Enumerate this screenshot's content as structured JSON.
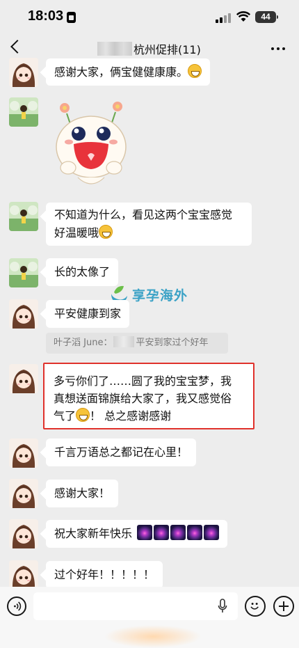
{
  "status_bar": {
    "time": "18:03",
    "battery": "44"
  },
  "header": {
    "title": "杭州促排(11)"
  },
  "messages": [
    {
      "avatar": "girl-avatar",
      "text": "感谢大家，俩宝健健康康。"
    },
    {
      "avatar": "landscape-avatar",
      "sticker": "cartoon-face-sticker"
    },
    {
      "avatar": "landscape-avatar",
      "text_line1": "不知道为什么，看见这两个宝宝感觉",
      "text_line2": "好温暖哦"
    },
    {
      "avatar": "landscape-avatar",
      "text": "长的太像了"
    },
    {
      "avatar": "girl-avatar",
      "text": "平安健康到家"
    },
    {
      "quote_prefix": "叶子滔 June：",
      "quote_suffix": "平安到家过个好年"
    },
    {
      "avatar": "girl-avatar",
      "text_line1": "多亏你们了……圆了我的宝宝梦，我",
      "text_line2": "真想送面锦旗给大家了，我又感觉俗",
      "text_line3_a": "气了",
      "text_line3_b": "！ 总之感谢感谢"
    },
    {
      "avatar": "girl-avatar",
      "text": "千言万语总之都记在心里！"
    },
    {
      "avatar": "girl-avatar",
      "text": "感谢大家！"
    },
    {
      "avatar": "girl-avatar",
      "text": "祝大家新年快乐"
    },
    {
      "avatar": "girl-avatar",
      "text": "过个好年！！！！！"
    }
  ],
  "watermark": {
    "text": "享孕海外"
  },
  "icons": {
    "back": "chevron-left-icon",
    "more": "more-dots-icon",
    "voice": "voice-icon",
    "mic": "microphone-icon",
    "emoji": "emoji-icon",
    "plus": "plus-icon"
  },
  "colors": {
    "highlight_border": "#e0312b",
    "background": "#ededed",
    "watermark": "#3ba2c6"
  }
}
